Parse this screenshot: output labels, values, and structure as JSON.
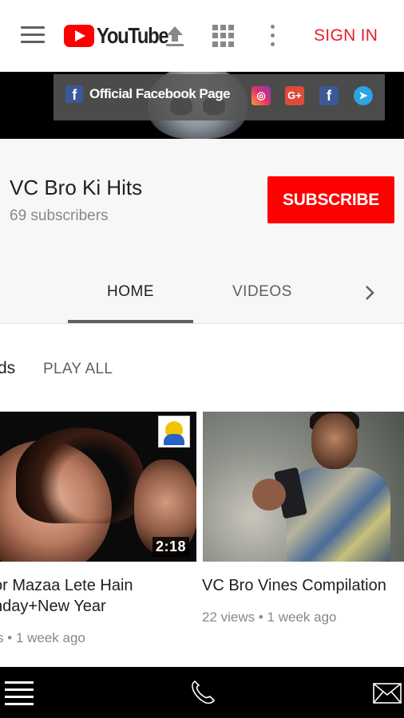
{
  "header": {
    "logo_text": "YouTube",
    "sign_in": "SIGN IN",
    "brand_color": "#ff0000",
    "sign_in_color": "#e61e2b"
  },
  "banner": {
    "facebook_link": "Official Facebook Page",
    "social_icons": [
      "instagram-icon",
      "google-plus-icon",
      "facebook-icon",
      "telegram-icon"
    ]
  },
  "channel": {
    "name": "VC Bro Ki Hits",
    "subscribers": "69 subscribers",
    "subscribe_label": "SUBSCRIBE"
  },
  "tabs": [
    {
      "label": "HOME",
      "active": true
    },
    {
      "label": "VIDEOS",
      "active": false
    }
  ],
  "section": {
    "title_fragment": "ds",
    "play_all": "PLAY ALL"
  },
  "videos": [
    {
      "title": "or Mazaa Lete Hain nday+New Year",
      "title_lines": [
        "or Mazaa Lete Hain",
        "nday+New Year"
      ],
      "meta": "s • 1 week ago",
      "duration": "2:18"
    },
    {
      "title": "VC Bro Vines Compilation",
      "meta": "22 views • 1 week ago"
    }
  ],
  "bottom_bar": {
    "icons": [
      "menu-icon",
      "phone-icon",
      "mail-icon"
    ]
  }
}
